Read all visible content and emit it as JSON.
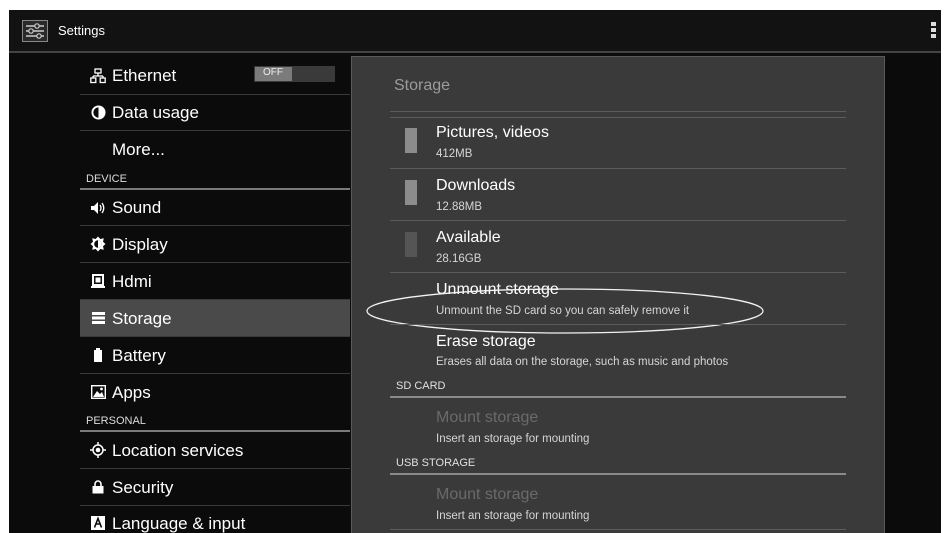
{
  "app": {
    "title": "Settings"
  },
  "sidebar": {
    "items": [
      {
        "label": "Ethernet",
        "icon": "network-icon",
        "toggle": "OFF"
      },
      {
        "label": "Data usage",
        "icon": "data-usage-icon"
      },
      {
        "label": "More..."
      },
      {
        "label": "Sound",
        "icon": "volume-icon"
      },
      {
        "label": "Display",
        "icon": "brightness-icon"
      },
      {
        "label": "Hdmi",
        "icon": "hdmi-icon"
      },
      {
        "label": "Storage",
        "icon": "storage-icon",
        "selected": true
      },
      {
        "label": "Battery",
        "icon": "battery-icon"
      },
      {
        "label": "Apps",
        "icon": "apps-icon"
      },
      {
        "label": "Location services",
        "icon": "location-icon"
      },
      {
        "label": "Security",
        "icon": "lock-icon"
      },
      {
        "label": "Language & input",
        "icon": "keyboard-icon"
      }
    ],
    "headers": {
      "device": "DEVICE",
      "personal": "PERSONAL"
    }
  },
  "panel": {
    "title": "Storage",
    "items": [
      {
        "title": "Pictures, videos",
        "subtitle": "412MB"
      },
      {
        "title": "Downloads",
        "subtitle": "12.88MB"
      },
      {
        "title": "Available",
        "subtitle": "28.16GB"
      },
      {
        "title": "Unmount storage",
        "subtitle": "Unmount the SD card so you can safely remove it"
      },
      {
        "title": "Erase storage",
        "subtitle": "Erases all data on the storage, such as music and photos"
      }
    ],
    "sd_card": {
      "header": "SD CARD",
      "item": {
        "title": "Mount storage",
        "subtitle": "Insert an storage for mounting"
      }
    },
    "usb_storage": {
      "header": "USB STORAGE",
      "item": {
        "title": "Mount storage",
        "subtitle": "Insert an storage for mounting"
      }
    }
  },
  "colors": {
    "background": "#0b0b0b",
    "panel": "#3a3a3a",
    "selected": "#4a4a4a",
    "disabled_text": "#6a6a6a"
  }
}
